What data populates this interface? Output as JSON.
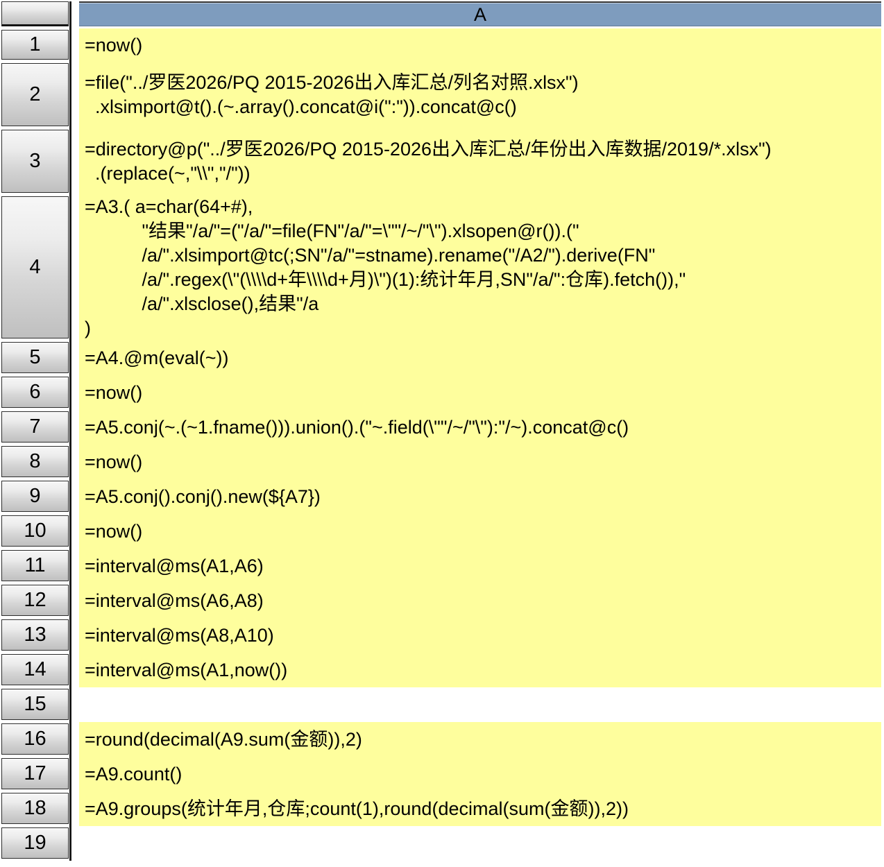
{
  "colors": {
    "column_header_bg": "#7E9CBE",
    "filled_cell_bg": "#FEFE9D",
    "empty_cell_bg": "#FFFFFF",
    "cell_text": "#000000",
    "row_header_text": "#000000"
  },
  "grid": {
    "column_header": "A",
    "rows": [
      {
        "n": "1",
        "text": "=now()",
        "filled": true
      },
      {
        "n": "2",
        "text": "=file(\"../罗医2026/PQ 2015-2026出入库汇总/列名对照.xlsx\")\n  .xlsimport@t().(~.array().concat@i(\":\")).concat@c()",
        "filled": true
      },
      {
        "n": "3",
        "text": "=directory@p(\"../罗医2026/PQ 2015-2026出入库汇总/年份出入库数据/2019/*.xlsx\")\n  .(replace(~,\"\\\\\",\"/\"))",
        "filled": true
      },
      {
        "n": "4",
        "text": "=A3.( a=char(64+#),\n           \"结果\"/a/\"=(\"/a/\"=file(FN\"/a/\"=\\\"\"/~/\"\\\").xlsopen@r()).(\"\n           /a/\".xlsimport@tc(;SN\"/a/\"=stname).rename(\"/A2/\").derive(FN\"\n           /a/\".regex(\\\"(\\\\\\\\d+年\\\\\\\\d+月)\\\")(1):统计年月,SN\"/a/\":仓库).fetch()),\"\n           /a/\".xlsclose(),结果\"/a\n)",
        "filled": true
      },
      {
        "n": "5",
        "text": "=A4.@m(eval(~))",
        "filled": true
      },
      {
        "n": "6",
        "text": "=now()",
        "filled": true
      },
      {
        "n": "7",
        "text": "=A5.conj(~.(~1.fname())).union().(\"~.field(\\\"\"/~/\"\\\"):\"/~).concat@c()",
        "filled": true
      },
      {
        "n": "8",
        "text": "=now()",
        "filled": true
      },
      {
        "n": "9",
        "text": "=A5.conj().conj().new(${A7})",
        "filled": true
      },
      {
        "n": "10",
        "text": "=now()",
        "filled": true
      },
      {
        "n": "11",
        "text": "=interval@ms(A1,A6)",
        "filled": true
      },
      {
        "n": "12",
        "text": "=interval@ms(A6,A8)",
        "filled": true
      },
      {
        "n": "13",
        "text": "=interval@ms(A8,A10)",
        "filled": true
      },
      {
        "n": "14",
        "text": "=interval@ms(A1,now())",
        "filled": true
      },
      {
        "n": "15",
        "text": "",
        "filled": false
      },
      {
        "n": "16",
        "text": "=round(decimal(A9.sum(金额)),2)",
        "filled": true
      },
      {
        "n": "17",
        "text": "=A9.count()",
        "filled": true
      },
      {
        "n": "18",
        "text": "=A9.groups(统计年月,仓库;count(1),round(decimal(sum(金额)),2))",
        "filled": true
      },
      {
        "n": "19",
        "text": "",
        "filled": false
      }
    ]
  }
}
